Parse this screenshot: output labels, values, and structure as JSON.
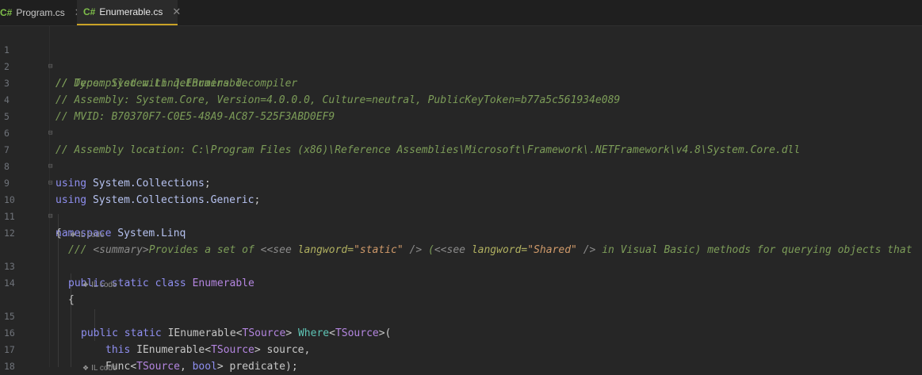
{
  "tabs": [
    {
      "lang": "C#",
      "label": "Program.cs",
      "close": "✕"
    },
    {
      "lang": "C#",
      "label": "Enumerable.cs",
      "close": "✕"
    }
  ],
  "line_numbers": [
    "1",
    "2",
    "3",
    "4",
    "5",
    "6",
    "7",
    "8",
    "9",
    "10",
    "11",
    "12",
    "13",
    "14",
    "15",
    "16",
    "17",
    "18"
  ],
  "il_code_label": "IL code",
  "code": {
    "l1": "// Decompiled with JetBrains decompiler",
    "l2": "// Type: System.Linq.Enumerable",
    "l3": "// Assembly: System.Core, Version=4.0.0.0, Culture=neutral, PublicKeyToken=b77a5c561934e089",
    "l4": "// MVID: B70370F7-C0E5-48A9-AC87-525F3ABD0EF9",
    "l5": "// Assembly location: C:\\Program Files (x86)\\Reference Assemblies\\Microsoft\\Framework\\.NETFramework\\v4.8\\System.Core.dll",
    "using": "using",
    "ns_collections": "System.Collections",
    "ns_generic": "System.Collections.Generic",
    "semicolon": ";",
    "namespace_kw": "namespace",
    "ns_linq": "System.Linq",
    "open_brace": "{",
    "doc_prefix": "/// ",
    "summary_open": "<summary>",
    "doc_text1": "Provides a set of ",
    "see_open": "<see ",
    "langword_attr": "langword=",
    "static_str": "\"static\"",
    "see_close": " />",
    "doc_text2": " (",
    "shared_str": "\"Shared\"",
    "doc_text3": " in Visual Basic) methods for querying objects that",
    "public_kw": "public",
    "static_kw": "static",
    "class_kw": "class",
    "class_name": "Enumerable",
    "ienum": "IEnumerable",
    "tsource": "TSource",
    "where": "Where",
    "this_kw": "this",
    "source": " source,",
    "func": "Func",
    "bool_kw": "bool",
    "predicate": " predicate);"
  }
}
